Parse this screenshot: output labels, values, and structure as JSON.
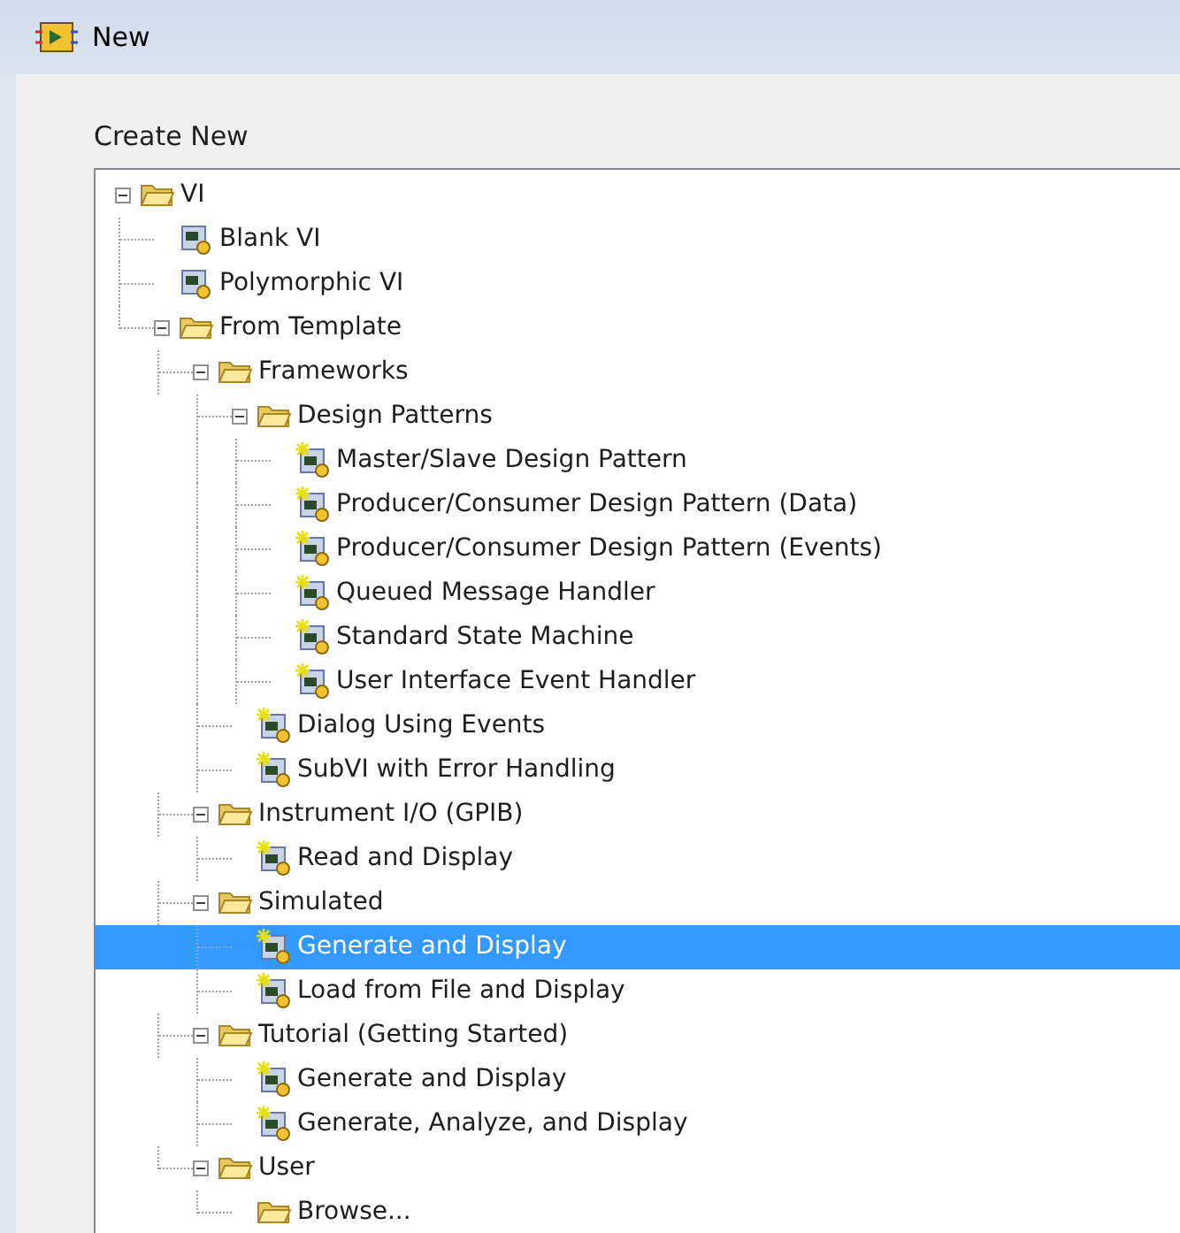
{
  "window": {
    "title": "New"
  },
  "section_label": "Create New",
  "tree": [
    {
      "label": "VI",
      "kind": "folder",
      "expanded": true,
      "selected": false,
      "children": [
        {
          "label": "Blank VI",
          "kind": "vi",
          "selected": false
        },
        {
          "label": "Polymorphic VI",
          "kind": "vi",
          "selected": false
        },
        {
          "label": "From Template",
          "kind": "folder",
          "expanded": true,
          "selected": false,
          "children": [
            {
              "label": "Frameworks",
              "kind": "folder",
              "expanded": true,
              "selected": false,
              "children": [
                {
                  "label": "Design Patterns",
                  "kind": "folder",
                  "expanded": true,
                  "selected": false,
                  "children": [
                    {
                      "label": "Master/Slave Design Pattern",
                      "kind": "template",
                      "selected": false
                    },
                    {
                      "label": "Producer/Consumer Design Pattern (Data)",
                      "kind": "template",
                      "selected": false
                    },
                    {
                      "label": "Producer/Consumer Design Pattern (Events)",
                      "kind": "template",
                      "selected": false
                    },
                    {
                      "label": "Queued Message Handler",
                      "kind": "template",
                      "selected": false
                    },
                    {
                      "label": "Standard State Machine",
                      "kind": "template",
                      "selected": false
                    },
                    {
                      "label": "User Interface Event Handler",
                      "kind": "template",
                      "selected": false
                    }
                  ]
                },
                {
                  "label": "Dialog Using Events",
                  "kind": "template",
                  "selected": false
                },
                {
                  "label": "SubVI with Error Handling",
                  "kind": "template",
                  "selected": false
                }
              ]
            },
            {
              "label": "Instrument I/O (GPIB)",
              "kind": "folder",
              "expanded": true,
              "selected": false,
              "children": [
                {
                  "label": "Read and Display",
                  "kind": "template",
                  "selected": false
                }
              ]
            },
            {
              "label": "Simulated",
              "kind": "folder",
              "expanded": true,
              "selected": false,
              "children": [
                {
                  "label": "Generate and Display",
                  "kind": "template",
                  "selected": true
                },
                {
                  "label": "Load from File and Display",
                  "kind": "template",
                  "selected": false
                }
              ]
            },
            {
              "label": "Tutorial (Getting Started)",
              "kind": "folder",
              "expanded": true,
              "selected": false,
              "children": [
                {
                  "label": "Generate and Display",
                  "kind": "template",
                  "selected": false
                },
                {
                  "label": "Generate, Analyze, and Display",
                  "kind": "template",
                  "selected": false
                }
              ]
            },
            {
              "label": "User",
              "kind": "folder",
              "expanded": true,
              "selected": false,
              "children": [
                {
                  "label": "Browse...",
                  "kind": "folder",
                  "selected": false
                }
              ]
            }
          ]
        }
      ]
    }
  ]
}
